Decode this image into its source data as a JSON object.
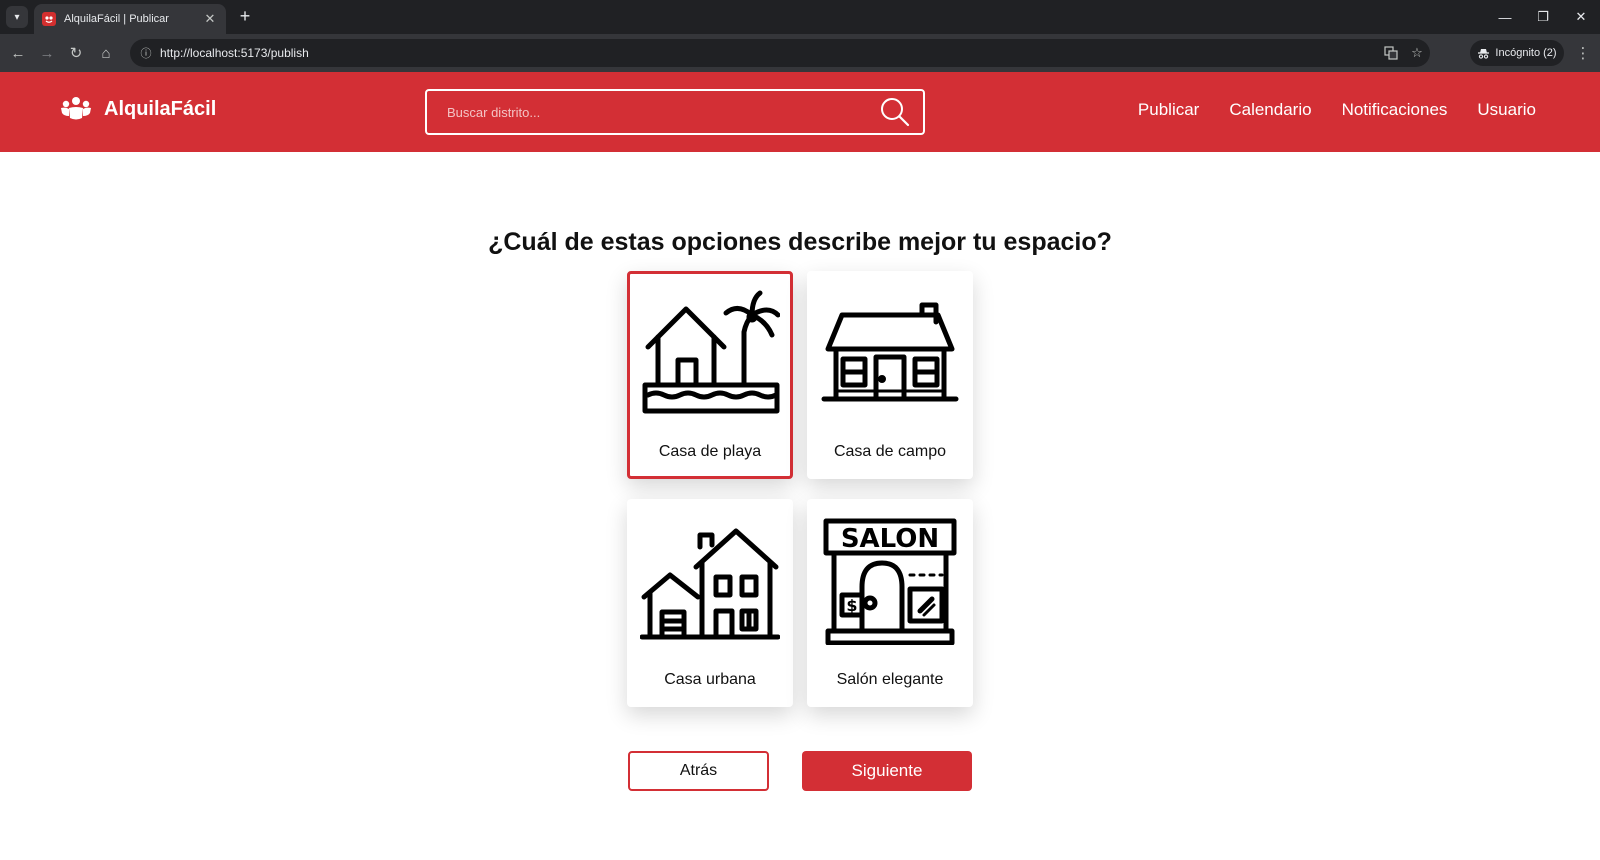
{
  "browser": {
    "tab_title": "AlquilaFácil | Publicar",
    "url": "http://localhost:5173/publish",
    "incognito_label": "Incógnito (2)"
  },
  "header": {
    "brand": "AlquilaFácil",
    "search_placeholder": "Buscar distrito...",
    "nav": [
      "Publicar",
      "Calendario",
      "Notificaciones",
      "Usuario"
    ]
  },
  "main": {
    "question": "¿Cuál de estas opciones describe mejor tu espacio?",
    "options": [
      {
        "label": "Casa de playa",
        "icon": "beach-house-icon",
        "selected": true
      },
      {
        "label": "Casa de campo",
        "icon": "country-house-icon",
        "selected": false
      },
      {
        "label": "Casa urbana",
        "icon": "city-house-icon",
        "selected": false
      },
      {
        "label": "Salón elegante",
        "icon": "salon-icon",
        "selected": false
      }
    ],
    "salon_sign": "SALON",
    "back_label": "Atrás",
    "next_label": "Siguiente"
  },
  "colors": {
    "brand": "#d32f35",
    "chrome_dark": "#202124"
  }
}
